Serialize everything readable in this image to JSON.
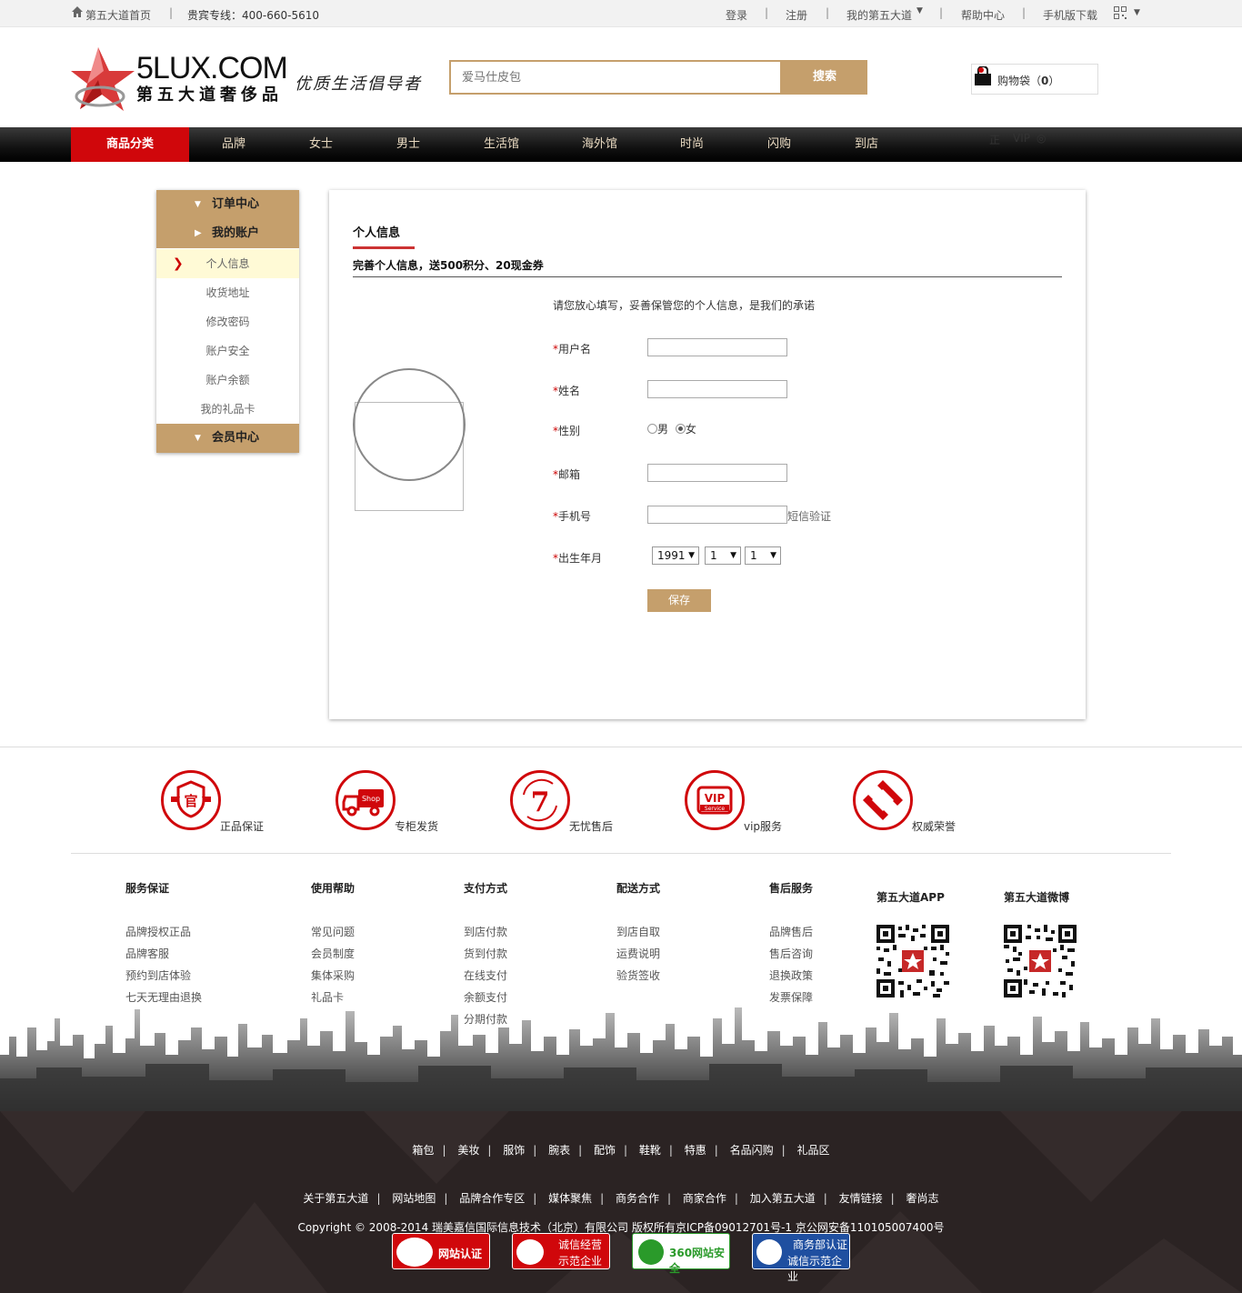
{
  "topbar": {
    "home": "第五大道首页",
    "hotline": "贵宾专线：400-660-5610",
    "login": "登录",
    "register": "注册",
    "my_account": "我的第五大道",
    "help": "帮助中心",
    "mobile": "手机版下载"
  },
  "header": {
    "logo_latin": "5LUX.COM",
    "logo_cn": "第五大道奢侈品",
    "slogan": "优质生活倡导者",
    "search_placeholder": "爱马仕皮包",
    "search_button": "搜索",
    "cart_label": "购物袋（",
    "cart_count": "0",
    "cart_close": "）"
  },
  "nav": {
    "category": "商品分类",
    "items": [
      "品牌",
      "女士",
      "男士",
      "生活馆",
      "海外馆",
      "时尚",
      "闪购",
      "到店"
    ],
    "badges": [
      "正",
      "VIP",
      "◎"
    ]
  },
  "sidebar": {
    "order_center": "订单中心",
    "my_account": "我的账户",
    "items": [
      "个人信息",
      "收货地址",
      "修改密码",
      "账户安全",
      "账户余额",
      "我的礼品卡"
    ],
    "member_center": "会员中心"
  },
  "panel": {
    "title": "个人信息",
    "subtitle": "完善个人信息，送500积分、20现金券",
    "note": "请您放心填写，妥善保管您的个人信息，是我们的承诺",
    "fields": {
      "username": "用户名",
      "name": "姓名",
      "gender": "性别",
      "male": "男",
      "female": "女",
      "email": "邮箱",
      "phone": "手机号",
      "sms": "短信验证",
      "birth": "出生年月"
    },
    "birth_year": "1991",
    "birth_month": "1",
    "birth_day": "1",
    "save": "保存"
  },
  "services": [
    "正品保证",
    "专柜发货",
    "无忧售后",
    "vip服务",
    "权威荣誉"
  ],
  "footer_columns": [
    {
      "title": "服务保证",
      "items": [
        "品牌授权正品",
        "品牌客服",
        "预约到店体验",
        "七天无理由退换"
      ]
    },
    {
      "title": "使用帮助",
      "items": [
        "常见问题",
        "会员制度",
        "集体采购",
        "礼品卡"
      ]
    },
    {
      "title": "支付方式",
      "items": [
        "到店付款",
        "货到付款",
        "在线支付",
        "余额支付",
        "分期付款"
      ]
    },
    {
      "title": "配送方式",
      "items": [
        "到店自取",
        "运费说明",
        "验货签收"
      ]
    },
    {
      "title": "售后服务",
      "items": [
        "品牌售后",
        "售后咨询",
        "退换政策",
        "发票保障"
      ]
    }
  ],
  "qr": {
    "app": "第五大道APP",
    "weibo": "第五大道微博"
  },
  "bottom_links1": [
    "箱包",
    "美妆",
    "服饰",
    "腕表",
    "配饰",
    "鞋靴",
    "特惠",
    "名品闪购",
    "礼品区"
  ],
  "bottom_links2": [
    "关于第五大道",
    "网站地图",
    "品牌合作专区",
    "媒体聚焦",
    "商务合作",
    "商家合作",
    "加入第五大道",
    "友情链接",
    "奢尚志"
  ],
  "copyright": "Copyright © 2008-2014 瑞美嘉信国际信息技术（北京）有限公司 版权所有京ICP备09012701号-1 京公网安备110105007400号",
  "certs": {
    "c1": "网站认证",
    "c2a": "诚信经营",
    "c2b": "示范企业",
    "c3": "360网站安全",
    "c4a": "商务部认证",
    "c4b": "诚信示范企业"
  },
  "colors": {
    "accent": "#c59f6c",
    "red": "#d0070b",
    "dark_footer": "#2b2323"
  }
}
